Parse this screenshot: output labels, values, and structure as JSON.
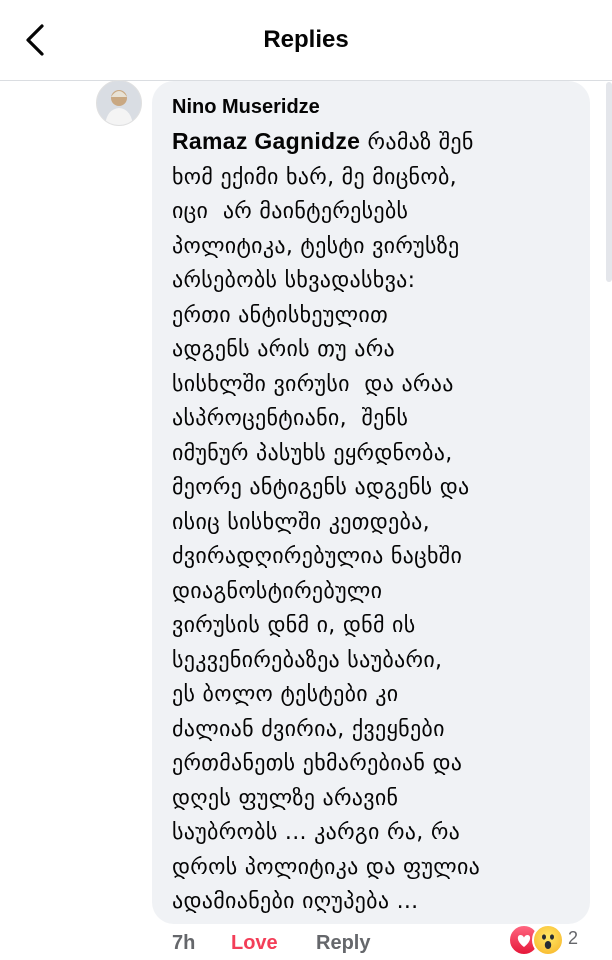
{
  "header": {
    "title": "Replies",
    "back_icon": "chevron-left-icon"
  },
  "comment": {
    "author": "Nino Museridze",
    "mention": "Ramaz Gagnidze",
    "lines": [
      " რამაზ შენ",
      "ხომ ექიმი ხარ, მე მიცნობ,",
      "იცი  არ მაინტერესებს",
      "პოლიტიკა, ტესტი ვირუსზე",
      "არსებობს სხვადასხვა:",
      "ერთი ანტისხეულით",
      "ადგენს არის თუ არა",
      "სისხლში ვირუსი  და არაა",
      "ასპროცენტიანი,  შენს",
      "იმუნურ პასუხს ეყრდნობა,",
      "მეორე ანტიგენს ადგენს და",
      "ისიც სისხლში კეთდება,",
      "ძვირადღირებულია ნაცხში",
      "დიაგნოსტირებული",
      "ვირუსის დნმ ი, დნმ ის",
      "სეკვენირებაზეა საუბარი,",
      "ეს ბოლო ტესტები კი",
      "ძალიან ძვირია, ქვეყნები",
      "ერთმანეთს ეხმარებიან და",
      "დღეს ფულზე არავინ",
      "საუბრობს ... კარგი რა, რა",
      "დროს პოლიტიკა და ფულია",
      "ადამიანები იღუპება ..."
    ],
    "time": "7h",
    "love_label": "Love",
    "reply_label": "Reply",
    "reactions": {
      "icons": [
        "heart-reaction-icon",
        "wow-reaction-icon"
      ],
      "count": "2"
    }
  },
  "colors": {
    "love": "#f33e58",
    "bubble": "#f0f2f5",
    "secondary": "#65676b"
  }
}
